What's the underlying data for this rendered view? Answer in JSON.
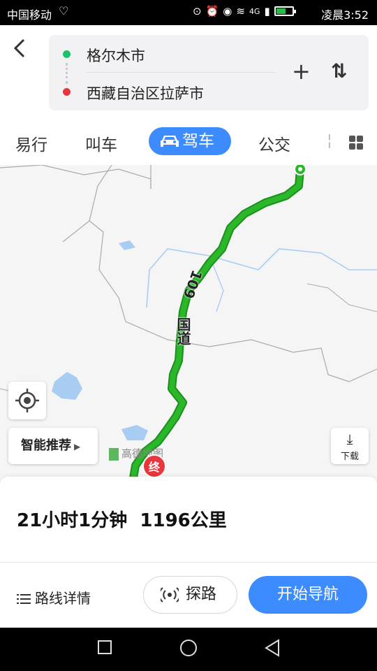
{
  "status_bar": {
    "carrier": "中国移动",
    "signal_type": "4G",
    "time": "凌晨3:52",
    "battery_level": 0.6
  },
  "route": {
    "from": "格尔木市",
    "to": "西藏自治区拉萨市"
  },
  "tabs": [
    {
      "label": "易行",
      "active": false
    },
    {
      "label": "叫车",
      "active": false
    },
    {
      "label": "驾车",
      "active": true
    },
    {
      "label": "公交",
      "active": false
    }
  ],
  "map": {
    "road_label_number": "109",
    "road_label_text": "国道",
    "smart_recommend": "智能推荐",
    "download_label": "下载",
    "logo_text": "高德地图",
    "end_marker": "终",
    "route_color": "#2ab72a",
    "accent_color": "#3c8cff"
  },
  "summary": {
    "duration": "21小时1分钟",
    "distance": "1196公里"
  },
  "actions": {
    "details": "路线详情",
    "probe": "探路",
    "start_navigation": "开始导航"
  }
}
